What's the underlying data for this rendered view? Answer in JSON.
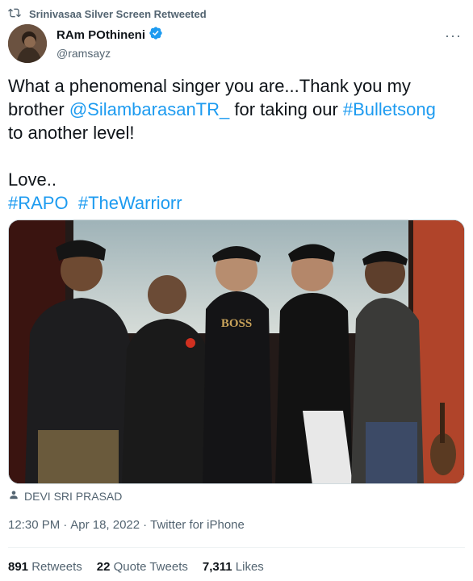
{
  "retweet_banner": {
    "text": "Srinivasaa Silver Screen Retweeted",
    "icon": "retweet-icon"
  },
  "author": {
    "display_name": "RAm POthineni",
    "handle": "@ramsayz",
    "verified": true,
    "verified_color": "#1d9bf0"
  },
  "more_options": "···",
  "tweet": {
    "line1": "What a phenomenal singer you are...Thank you my",
    "line2_pre": "brother ",
    "mention": "@SilambarasanTR_",
    "line2_mid": " for taking our ",
    "hashtag_bullet": "#Bulletsong",
    "line3": "to another level!",
    "love": "Love..",
    "hashtag_rapo": "#RAPO",
    "hashtag_warrior": "#TheWarriorr"
  },
  "photo": {
    "shirt_text": "BOSS"
  },
  "photo_credit": {
    "text": "DEVI SRI PRASAD",
    "icon": "person-icon"
  },
  "timestamp": {
    "time": "12:30 PM",
    "sep1": "·",
    "date": "Apr 18, 2022",
    "sep2": "·",
    "source": "Twitter for iPhone"
  },
  "stats": {
    "retweets_count": "891",
    "retweets_label": "Retweets",
    "quotes_count": "22",
    "quotes_label": "Quote Tweets",
    "likes_count": "7,311",
    "likes_label": "Likes"
  },
  "colors": {
    "link": "#1d9bf0",
    "secondary_text": "#536471"
  }
}
